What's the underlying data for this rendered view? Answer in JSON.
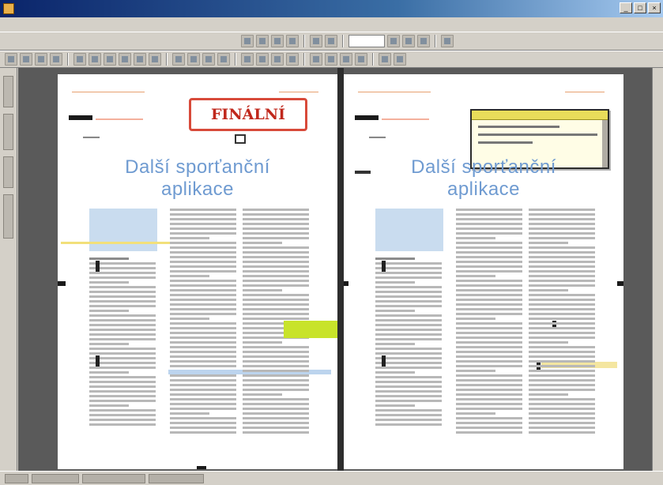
{
  "window": {
    "title": ""
  },
  "menu": {
    "items": [
      "",
      "",
      "",
      "",
      "",
      "",
      ""
    ]
  },
  "toolbar": {
    "zoom_value": ""
  },
  "left_page": {
    "heading_line1": "Další sporťanční",
    "heading_line2": "aplikace",
    "stamp_text": "FINÁLNÍ"
  },
  "right_page": {
    "heading_line1": "Další sporťanční",
    "heading_line2": "aplikace"
  },
  "colors": {
    "heading": "#6f9bd1",
    "stamp": "#d84a3a",
    "highlight_green": "#c8e32a",
    "highlight_yellow": "#f2e07a",
    "sidebar_box": "#c9dcef"
  }
}
